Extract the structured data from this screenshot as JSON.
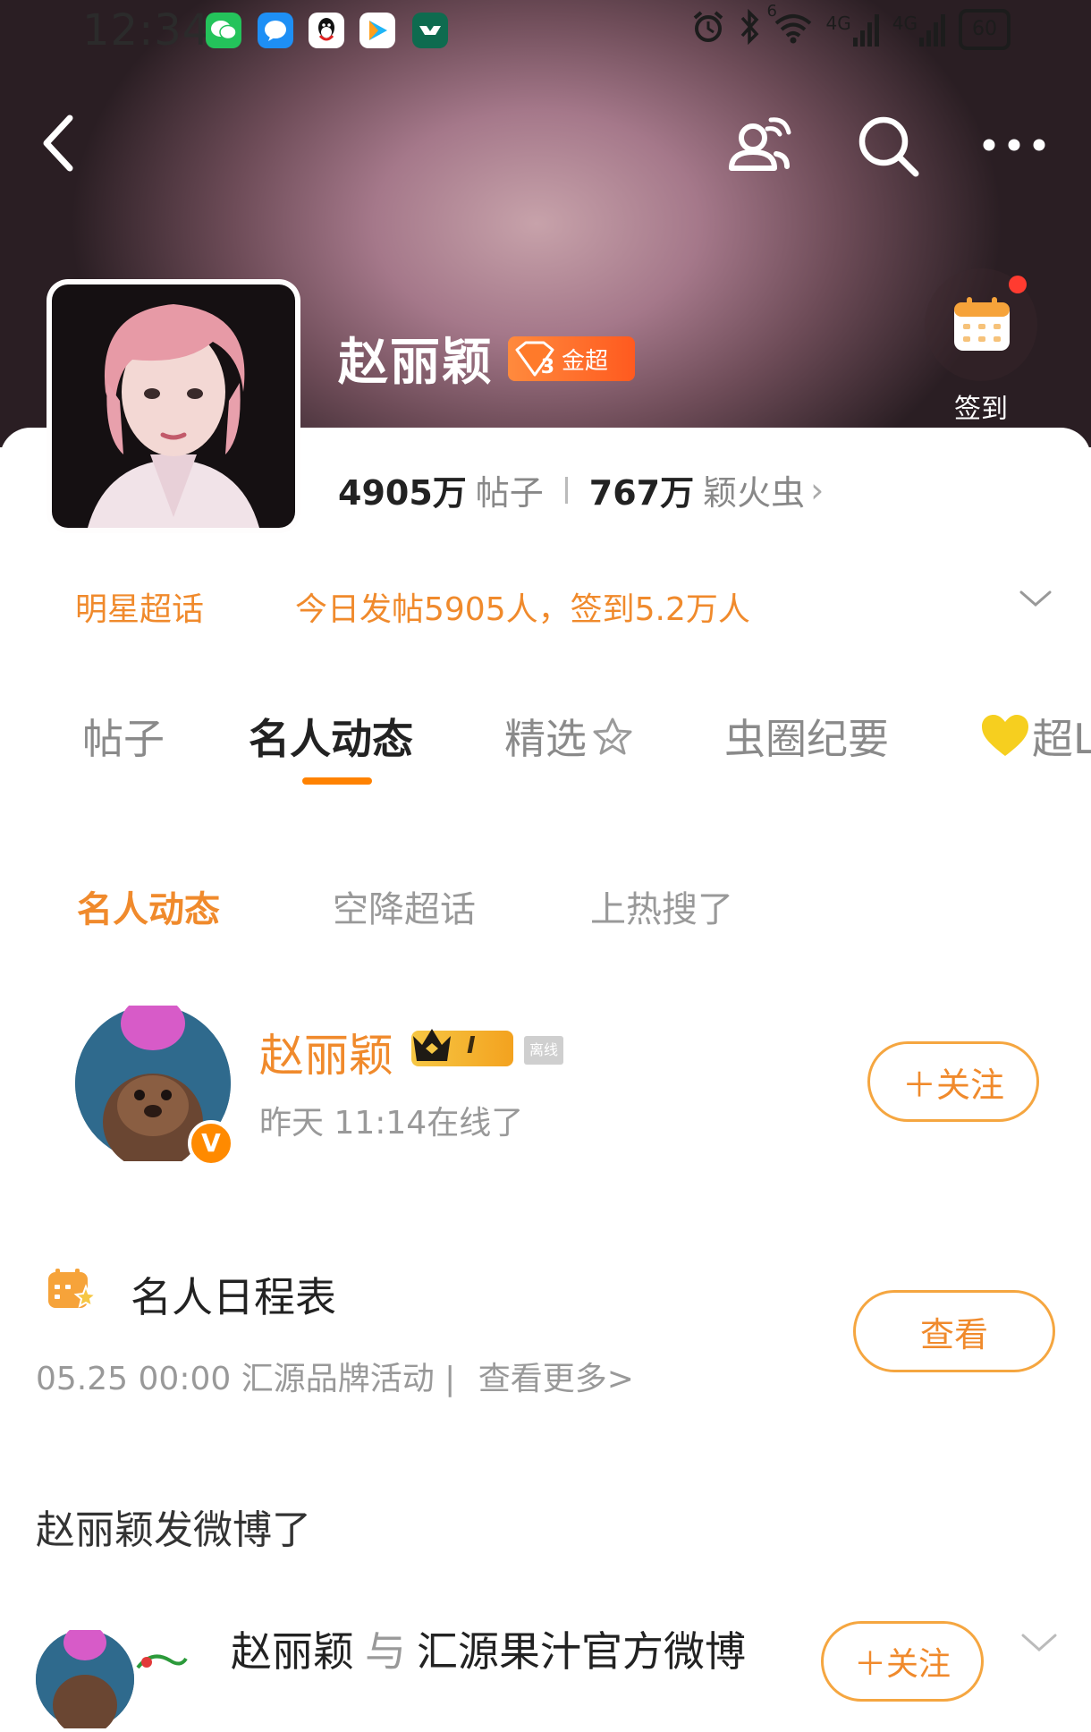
{
  "status_bar": {
    "time": "12:34",
    "network_1": "4G",
    "network_2": "4G",
    "wifi_sup": "6",
    "battery": "60"
  },
  "header": {
    "topic_name": "赵丽颖",
    "badge_level": "3",
    "badge_label": "金超",
    "checkin_label": "签到"
  },
  "stats": {
    "posts_count": "4905万",
    "posts_label": "帖子",
    "fans_count": "767万",
    "fans_label": "颖火虫",
    "fans_arrow": "›"
  },
  "info": {
    "category": "明星超话",
    "today": "今日发帖5905人，签到5.2万人"
  },
  "tabs": [
    {
      "label": "帖子"
    },
    {
      "label": "名人动态"
    },
    {
      "label": "精选"
    },
    {
      "label": "虫圈纪要"
    },
    {
      "label": "超L"
    }
  ],
  "subtabs": [
    {
      "label": "名人动态"
    },
    {
      "label": "空降超话"
    },
    {
      "label": "上热搜了"
    }
  ],
  "user_card": {
    "name": "赵丽颖",
    "crown_level": "I",
    "offline_tag": "离线",
    "last_online": "昨天 11:14在线了",
    "verified": "V",
    "follow_label": "＋关注"
  },
  "schedule": {
    "title": "名人日程表",
    "entry": "05.25 00:00 汇源品牌活动 |",
    "more": "查看更多>",
    "view_label": "查看"
  },
  "feed": {
    "heading": "赵丽颖发微博了",
    "author": "赵丽颖",
    "with": "与",
    "partner": "汇源果汁官方微博",
    "follow_label": "＋关注"
  },
  "colors": {
    "accent": "#ff8200",
    "accent_text": "#f08a2c",
    "badge": "#ff5a1f"
  }
}
